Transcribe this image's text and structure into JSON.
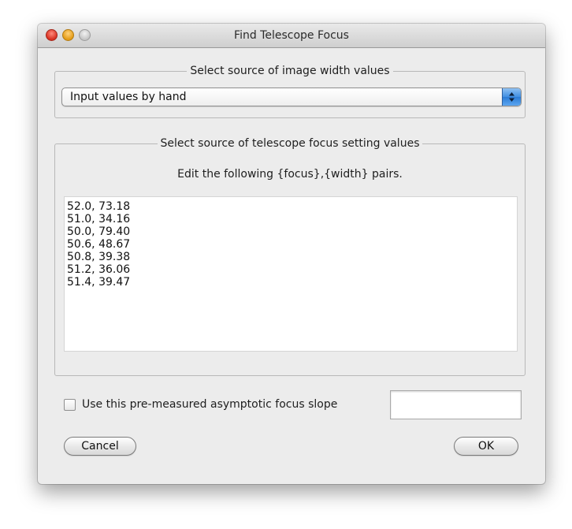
{
  "window": {
    "title": "Find Telescope Focus"
  },
  "width_source": {
    "legend": "Select source of image width values",
    "selected": "Input values by hand"
  },
  "focus_source": {
    "legend": "Select source of telescope focus setting values",
    "instruction": "Edit the following  {focus},{width}  pairs.",
    "pairs": [
      "52.0, 73.18",
      "51.0, 34.16",
      "50.0, 79.40",
      "50.6, 48.67",
      "50.8, 39.38",
      "51.2, 36.06",
      "51.4, 39.47"
    ]
  },
  "slope": {
    "checkbox_label": "Use this pre-measured asymptotic focus slope",
    "checked": false,
    "value": ""
  },
  "buttons": {
    "cancel": "Cancel",
    "ok": "OK"
  },
  "colors": {
    "close": "#d72f1f",
    "minimize": "#e39a14",
    "zoom": "#c4c4c4",
    "popup_accent": "#3f8ee2"
  },
  "icons": {
    "popup": "updown-chevrons-icon"
  }
}
